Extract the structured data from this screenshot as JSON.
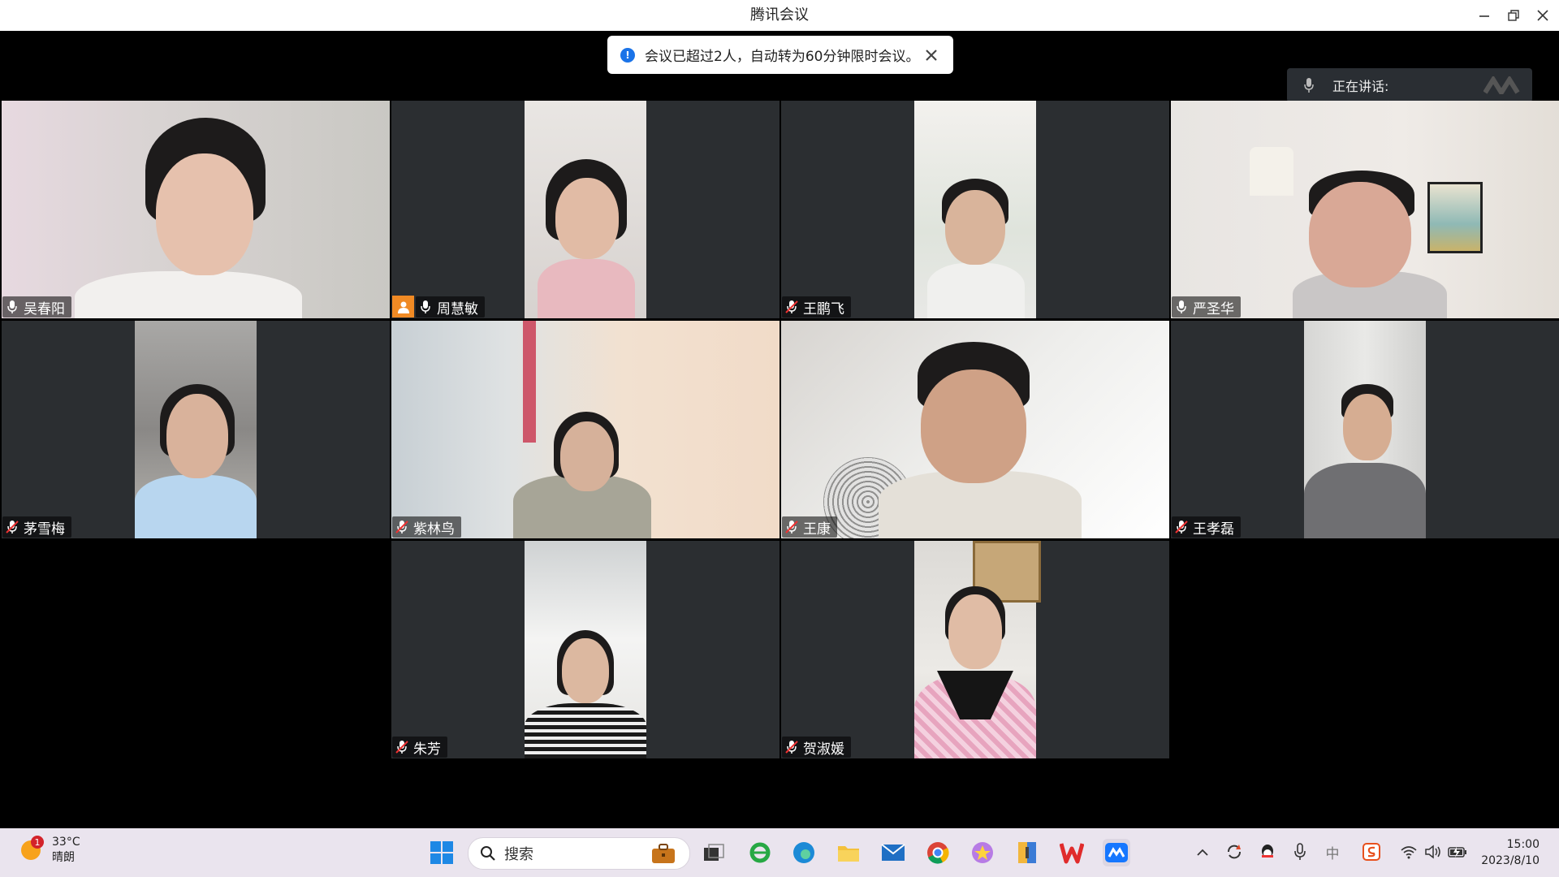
{
  "window": {
    "title": "腾讯会议"
  },
  "notification": {
    "message": "会议已超过2人，自动转为60分钟限时会议。"
  },
  "speaking": {
    "label": "正在讲话:"
  },
  "participants": [
    {
      "name": "吴春阳"
    },
    {
      "name": "周慧敏"
    },
    {
      "name": "王鹏飞"
    },
    {
      "name": "严圣华"
    },
    {
      "name": "茅雪梅"
    },
    {
      "name": "紫林鸟"
    },
    {
      "name": "王康"
    },
    {
      "name": "王孝磊"
    },
    {
      "name": "朱芳"
    },
    {
      "name": "贺淑媛"
    }
  ],
  "taskbar": {
    "weather_temp": "33°C",
    "weather_desc": "晴朗",
    "weather_badge": "1",
    "search_label": "搜索",
    "ime": "中",
    "time": "15:00",
    "date": "2023/8/10"
  }
}
